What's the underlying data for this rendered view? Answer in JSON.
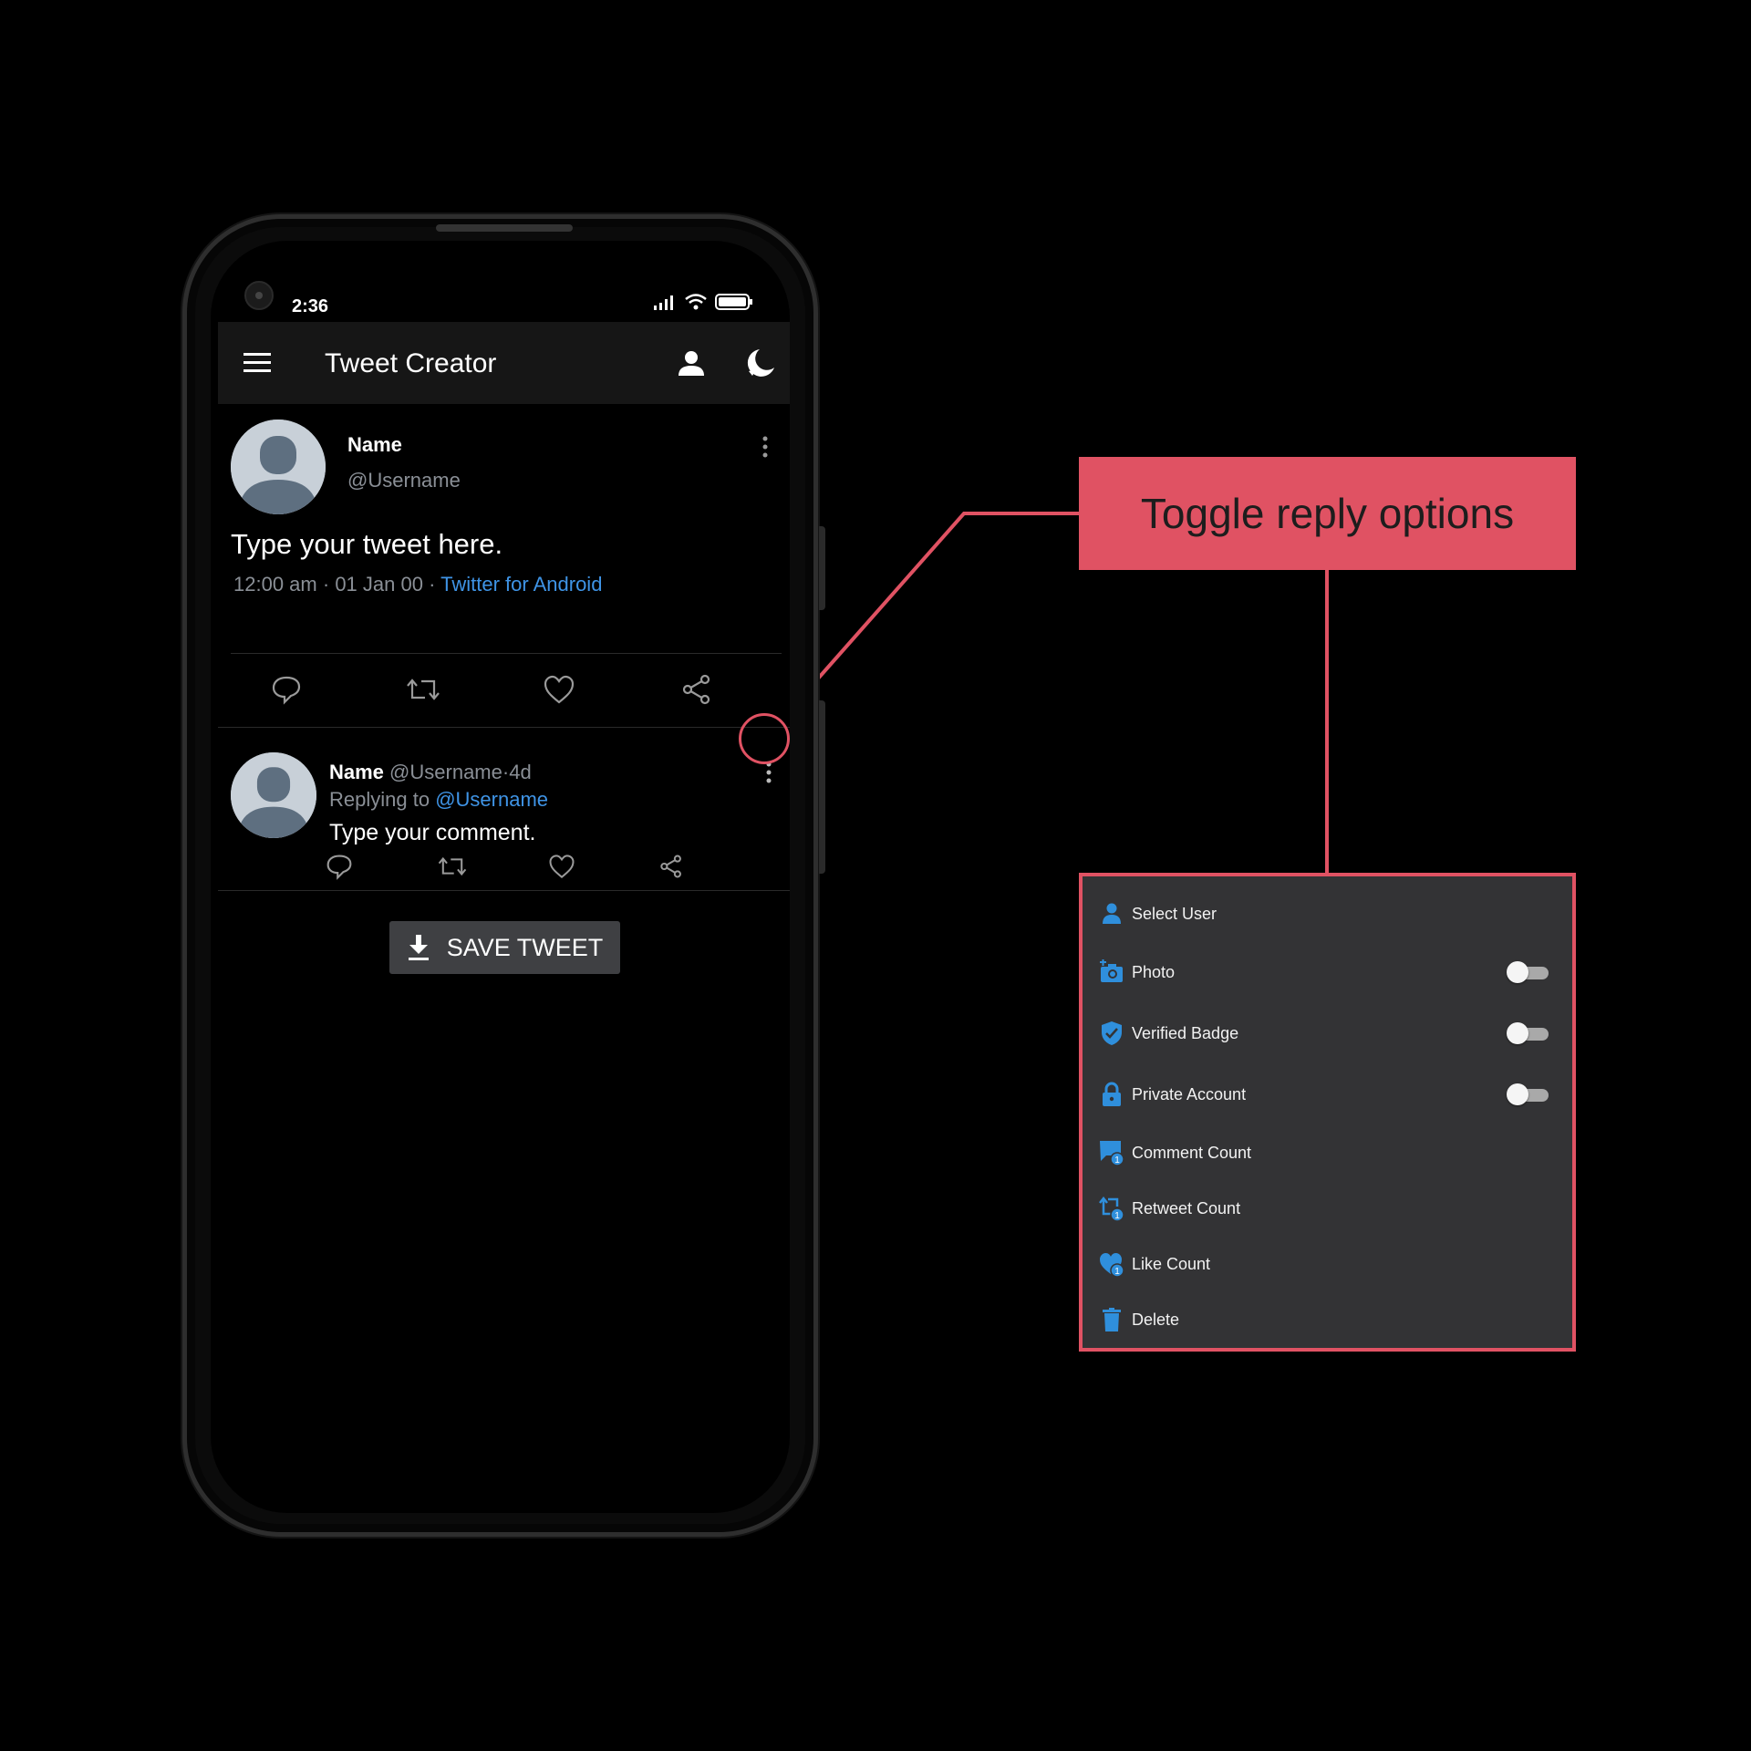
{
  "status_bar": {
    "time": "2:36"
  },
  "app_bar": {
    "title": "Tweet Creator"
  },
  "tweet": {
    "name": "Name",
    "handle": "@Username",
    "text": "Type your tweet here.",
    "time": "12:00 am",
    "date": "01 Jan 00",
    "source": "Twitter for Android",
    "separator": "·"
  },
  "reply": {
    "name": "Name",
    "handle": "@Username",
    "age": "4d",
    "replying_prefix": "Replying to",
    "replying_handle": "@Username",
    "text": "Type your comment."
  },
  "save_button": {
    "label": "SAVE TWEET"
  },
  "callout": {
    "label": "Toggle reply options"
  },
  "options_menu": {
    "items": [
      {
        "label": "Select User",
        "icon": "person-icon",
        "toggle": null
      },
      {
        "label": "Photo",
        "icon": "add-photo-icon",
        "toggle": false
      },
      {
        "label": "Verified Badge",
        "icon": "verified-shield-icon",
        "toggle": false
      },
      {
        "label": "Private Account",
        "icon": "lock-icon",
        "toggle": false
      },
      {
        "label": "Comment Count",
        "icon": "comment-count-icon",
        "toggle": null
      },
      {
        "label": "Retweet Count",
        "icon": "retweet-count-icon",
        "toggle": null
      },
      {
        "label": "Like Count",
        "icon": "like-count-icon",
        "toggle": null
      },
      {
        "label": "Delete",
        "icon": "trash-icon",
        "toggle": null
      }
    ],
    "count_badge": "1"
  },
  "colors": {
    "accent": "#e05263",
    "link": "#3f94e6",
    "icon_blue": "#2f8fdc",
    "panel": "#333335",
    "appbar": "#161616"
  }
}
